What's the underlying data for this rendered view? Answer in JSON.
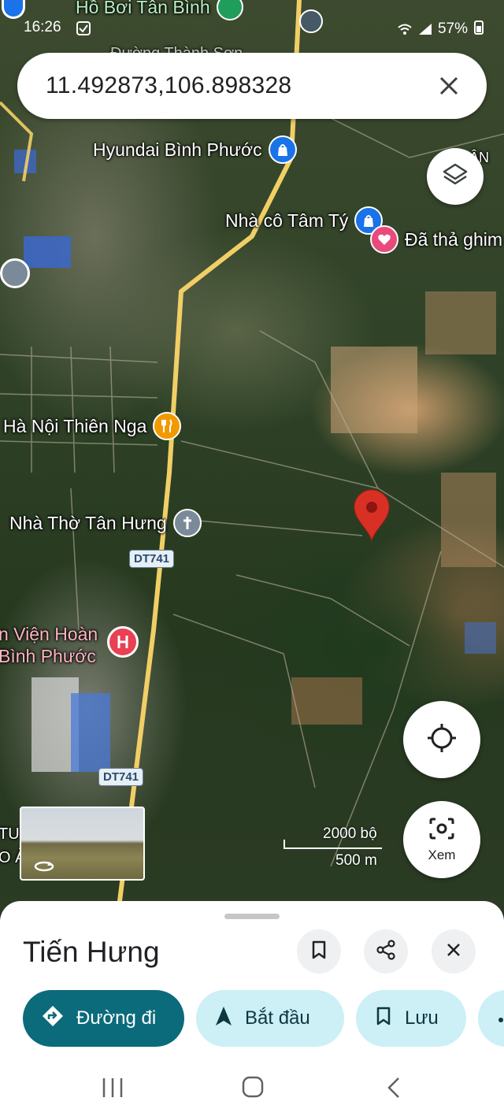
{
  "status_bar": {
    "time": "16:26",
    "battery": "57%"
  },
  "search": {
    "query": "11.492873,106.898328"
  },
  "map": {
    "pois": [
      {
        "label": "Hồ Bơi Tân Bình"
      },
      {
        "label": "Hyundai Bình Phước"
      },
      {
        "label": "Nhà cô Tâm Tý"
      },
      {
        "label": "Đã thả ghim"
      },
      {
        "label": "Hà Nội Thiên Nga"
      },
      {
        "label": "Nhà Thờ Tân Hưng"
      },
      {
        "label": "n Viện Hoàn"
      },
      {
        "label": "Bình Phước"
      },
      {
        "label": "ÂN"
      },
      {
        "label": "Đường Thành Sơn"
      },
      {
        "label": "TU"
      },
      {
        "label": "O Ả"
      }
    ],
    "road_shields": [
      "DT741",
      "DT741"
    ],
    "scale": {
      "imperial": "2000 bộ",
      "metric": "500 m"
    },
    "view_button_label": "Xem"
  },
  "sheet": {
    "title": "Tiến Hưng",
    "actions": [
      {
        "label": "Đường đi"
      },
      {
        "label": "Bắt đầu"
      },
      {
        "label": "Lưu"
      }
    ]
  },
  "colors": {
    "primary": "#0b6b7b",
    "chip_secondary": "#cdeff6",
    "pin_red": "#d93025",
    "poi_blue": "#1a73e8",
    "poi_orange": "#f29900",
    "poi_gray": "#7b8a99",
    "poi_red": "#e94054",
    "poi_pink": "#e94a7c",
    "road_yellow": "#f1cf66"
  }
}
